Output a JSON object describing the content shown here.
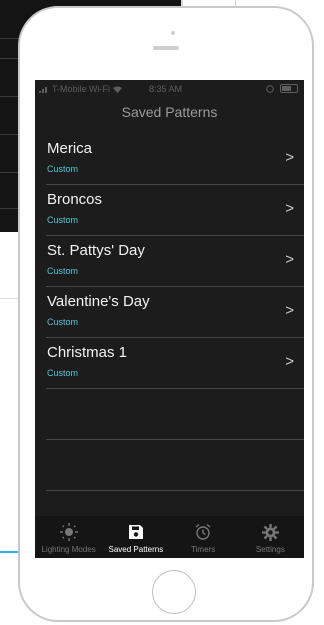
{
  "status_bar": {
    "carrier": "T-Mobile Wi-Fi",
    "time": "8:35 AM"
  },
  "nav": {
    "title": "Saved Patterns"
  },
  "patterns": [
    {
      "name": "Merica",
      "type": "Custom"
    },
    {
      "name": "Broncos",
      "type": "Custom"
    },
    {
      "name": "St. Pattys' Day",
      "type": "Custom"
    },
    {
      "name": "Valentine's Day",
      "type": "Custom"
    },
    {
      "name": "Christmas 1",
      "type": "Custom"
    }
  ],
  "tab_bar": {
    "tabs": [
      {
        "label": "Lighting Modes",
        "icon": "sun-icon",
        "active": false
      },
      {
        "label": "Saved Patterns",
        "icon": "save-icon",
        "active": true
      },
      {
        "label": "Timers",
        "icon": "alarm-clock-icon",
        "active": false
      },
      {
        "label": "Settings",
        "icon": "gear-icon",
        "active": false
      }
    ]
  },
  "colors": {
    "accent_subtitle": "#4fc7d8",
    "screen_bg": "#1c1c1c",
    "tab_active": "#ffffff",
    "tab_inactive": "#777777"
  }
}
